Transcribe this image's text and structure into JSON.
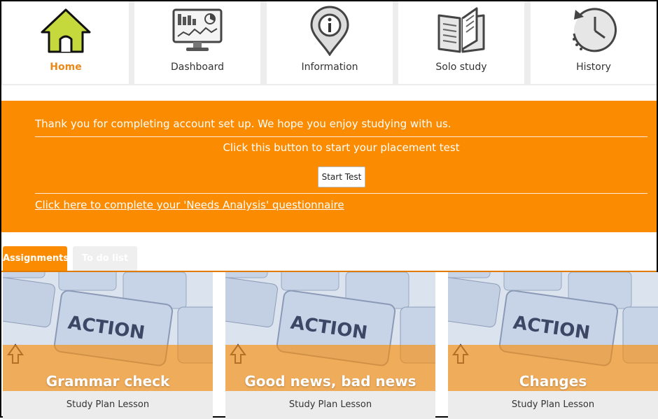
{
  "nav": {
    "items": [
      {
        "label": "Home",
        "icon": "house-icon",
        "active": true
      },
      {
        "label": "Dashboard",
        "icon": "monitor-chart-icon"
      },
      {
        "label": "Information",
        "icon": "info-pin-icon"
      },
      {
        "label": "Solo study",
        "icon": "open-book-icon"
      },
      {
        "label": "History",
        "icon": "clock-history-icon"
      }
    ],
    "active_color": "#e8891a",
    "home_icon_fill": "#c5d93c"
  },
  "banner": {
    "thanks": "Thank you for completing account set up. We hope you enjoy studying with us.",
    "placement_prompt": "Click this button to start your placement test",
    "start_button": "Start Test",
    "needs_link": "Click here to complete your 'Needs Analysis' questionnaire",
    "color": "#fb8b00"
  },
  "tabs": [
    {
      "label": "Assignments",
      "active": true
    },
    {
      "label": "To do list",
      "active": false
    }
  ],
  "cards": [
    {
      "title": "Grammar check",
      "subtitle": "Study Plan Lesson",
      "key_label": "ACTION"
    },
    {
      "title": "Good news, bad news",
      "subtitle": "Study Plan Lesson",
      "key_label": "ACTION"
    },
    {
      "title": "Changes",
      "subtitle": "Study Plan Lesson",
      "key_label": "ACTION"
    }
  ]
}
